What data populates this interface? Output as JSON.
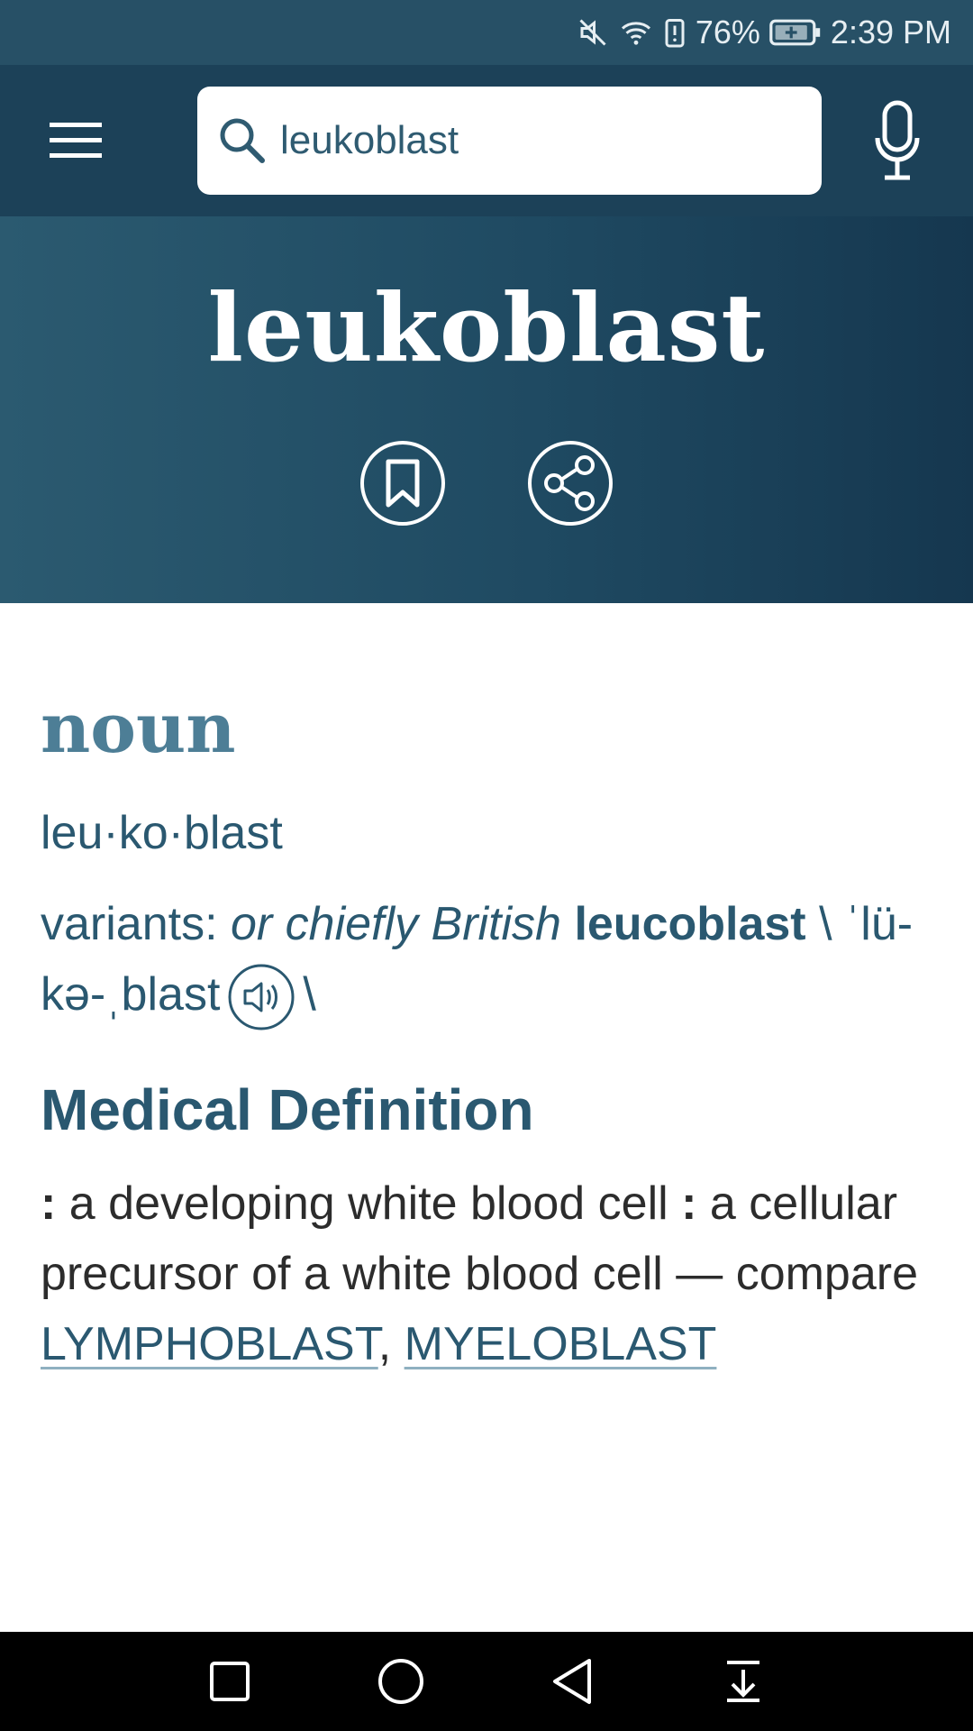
{
  "status_bar": {
    "battery_percent": "76%",
    "time": "2:39 PM",
    "icons": [
      "mute-icon",
      "wifi-icon",
      "battery-alert-icon",
      "battery-charging-icon"
    ]
  },
  "search": {
    "value": "leukoblast",
    "placeholder": ""
  },
  "entry": {
    "headword": "leukoblast",
    "part_of_speech": "noun",
    "syllables": "leu·ko·blast",
    "variants_label": "variants: ",
    "variants_qualifier": "or chiefly British",
    "variant_word": "leucoblast",
    "pron_open": " \\",
    "pronunciation": "ˈlü-kə-ˌblast",
    "pron_close": "\\",
    "section_title": "Medical Definition",
    "def_colon_1": ":",
    "def_text_1": " a developing white blood cell ",
    "def_colon_2": ":",
    "def_text_2": " a cellular precursor of a white blood cell — compare ",
    "xref_1": "LYMPHOBLAST",
    "xref_sep": ", ",
    "xref_2": "MYELOBLAST"
  },
  "colors": {
    "status_bar": "#275066",
    "top_bar": "#1c4158",
    "accent_text": "#2a5870",
    "pos_text": "#4d7e96"
  }
}
